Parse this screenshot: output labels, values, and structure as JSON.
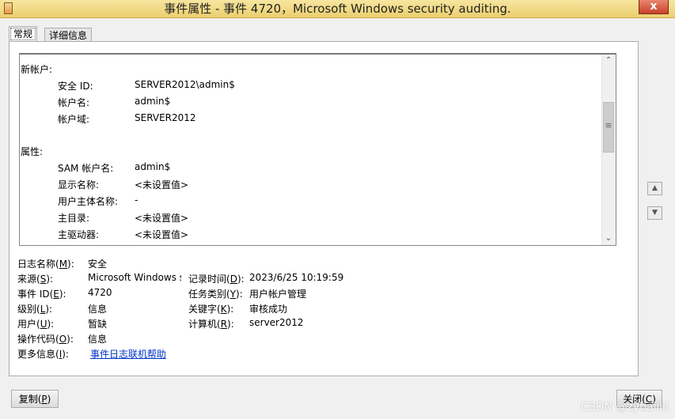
{
  "window": {
    "title": "事件属性 - 事件 4720，Microsoft Windows security auditing.",
    "close_glyph": "x"
  },
  "tabs": [
    {
      "label": "常规",
      "active": true
    },
    {
      "label": "详细信息",
      "active": false
    }
  ],
  "description": {
    "section_new_account": "新帐户:",
    "new_account": [
      {
        "label": "安全 ID:",
        "value": "SERVER2012\\admin$"
      },
      {
        "label": "帐户名:",
        "value": "admin$"
      },
      {
        "label": "帐户域:",
        "value": "SERVER2012"
      }
    ],
    "section_attributes": "属性:",
    "attributes": [
      {
        "label": "SAM 帐户名:",
        "value": "admin$"
      },
      {
        "label": "显示名称:",
        "value": "<未设置值>"
      },
      {
        "label": "用户主体名称:",
        "value": "-"
      },
      {
        "label": "主目录:",
        "value": "<未设置值>"
      },
      {
        "label": "主驱动器:",
        "value": "<未设置值>"
      }
    ]
  },
  "fields": {
    "log_name": {
      "label": "日志名称(",
      "key": "M",
      "suffix": "):",
      "value": "安全"
    },
    "source": {
      "label": "来源(",
      "key": "S",
      "suffix": "):",
      "value": "Microsoft Windows s"
    },
    "logged": {
      "label": "记录时间(",
      "key": "D",
      "suffix": "):",
      "value": "2023/6/25 10:19:59"
    },
    "event_id": {
      "label": "事件 ID(",
      "key": "E",
      "suffix": "):",
      "value": "4720"
    },
    "task_category": {
      "label": "任务类别(",
      "key": "Y",
      "suffix": "):",
      "value": "用户帐户管理"
    },
    "level": {
      "label": "级别(",
      "key": "L",
      "suffix": "):",
      "value": "信息"
    },
    "keywords": {
      "label": "关键字(",
      "key": "K",
      "suffix": "):",
      "value": "审核成功"
    },
    "user": {
      "label": "用户(",
      "key": "U",
      "suffix": "):",
      "value": "暂缺"
    },
    "computer": {
      "label": "计算机(",
      "key": "R",
      "suffix": "):",
      "value": "server2012"
    },
    "opcode": {
      "label": "操作代码(",
      "key": "O",
      "suffix": "):",
      "value": "信息"
    },
    "more_info": {
      "label": "更多信息(",
      "key": "I",
      "suffix": "):",
      "link": "事件日志联机帮助"
    }
  },
  "buttons": {
    "copy": {
      "label": "复制(",
      "key": "P",
      "suffix": ")"
    },
    "close": {
      "label": "关闭(",
      "key": "C",
      "suffix": ")"
    }
  },
  "watermark": "CSDN @zybaiiiii"
}
